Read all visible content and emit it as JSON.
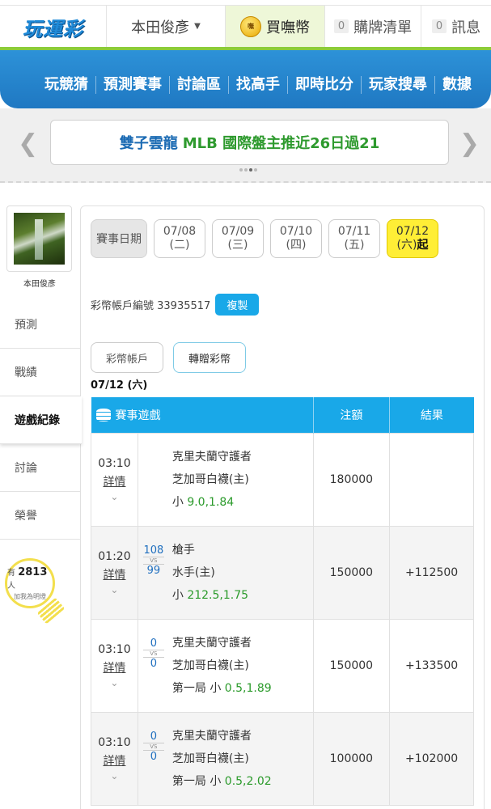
{
  "header": {
    "logo_text": "玩運彩",
    "username": "本田俊彥",
    "buy_coin_label": "買嘸幣",
    "cart_count": "0",
    "cart_label": "購牌清單",
    "msg_count": "0",
    "msg_label": "訊息"
  },
  "nav": {
    "items": [
      "玩競猜",
      "預測賽事",
      "討論區",
      "找高手",
      "即時比分",
      "玩家搜尋",
      "數據"
    ]
  },
  "banner": {
    "text_main": "雙子雲龍",
    "text_highlight": "MLB 國際盤主推近26日過21"
  },
  "sidebar": {
    "username": "本田俊彥",
    "items": [
      "預測",
      "戰績",
      "遊戲紀錄",
      "討論",
      "榮譽"
    ],
    "bulb_prefix": "有",
    "bulb_count": "2813",
    "bulb_suffix": "人",
    "bulb_text": "加我為明燈"
  },
  "main": {
    "date_label": "賽事日期",
    "dates": [
      {
        "date": "07/08",
        "day": "(二)"
      },
      {
        "date": "07/09",
        "day": "(三)"
      },
      {
        "date": "07/10",
        "day": "(四)"
      },
      {
        "date": "07/11",
        "day": "(五)"
      },
      {
        "date": "07/12",
        "day": "(六)",
        "suffix": "起"
      }
    ],
    "account_label": "彩幣帳戶編號 33935517",
    "copy_label": "複製",
    "tabs": [
      "彩幣帳戶",
      "轉贈彩幣"
    ],
    "date_title": "07/12 (六)",
    "table": {
      "headers": [
        "賽事遊戲",
        "注額",
        "結果"
      ],
      "rows": [
        {
          "time": "03:10",
          "detail": "詳情",
          "score_home": "",
          "score_away": "",
          "team1": "克里夫蘭守護者",
          "team2": "芝加哥白襪(主)",
          "bet_prefix": "小",
          "bet_line": "9.0",
          "bet_odds": "1.84",
          "amount": "180000",
          "result": ""
        },
        {
          "time": "01:20",
          "detail": "詳情",
          "score_home": "108",
          "score_away": "99",
          "team1": "槍手",
          "team2": "水手(主)",
          "bet_prefix": "小",
          "bet_line": "212.5",
          "bet_odds": "1.75",
          "amount": "150000",
          "result": "+112500"
        },
        {
          "time": "03:10",
          "detail": "詳情",
          "score_home": "0",
          "score_away": "0",
          "team1": "克里夫蘭守護者",
          "team2": "芝加哥白襪(主)",
          "bet_prefix": "第一局 小",
          "bet_line": "0.5",
          "bet_odds": "1.89",
          "amount": "150000",
          "result": "+133500"
        },
        {
          "time": "03:10",
          "detail": "詳情",
          "score_home": "0",
          "score_away": "0",
          "team1": "克里夫蘭守護者",
          "team2": "芝加哥白襪(主)",
          "bet_prefix": "第一局 小",
          "bet_line": "0.5",
          "bet_odds": "2.02",
          "amount": "100000",
          "result": "+102000"
        }
      ]
    }
  },
  "icons": [
    "coin-icon",
    "caret-down-icon",
    "arrow-left-icon",
    "arrow-right-icon",
    "database-icon",
    "chevron-down-icon",
    "lightbulb-icon"
  ],
  "colors": {
    "accent_blue": "#19a8e8",
    "nav_blue": "#1f78c2",
    "nav_green": "#8ccc3a",
    "active_date": "#ffee36",
    "win_green": "#2a9a2a"
  }
}
